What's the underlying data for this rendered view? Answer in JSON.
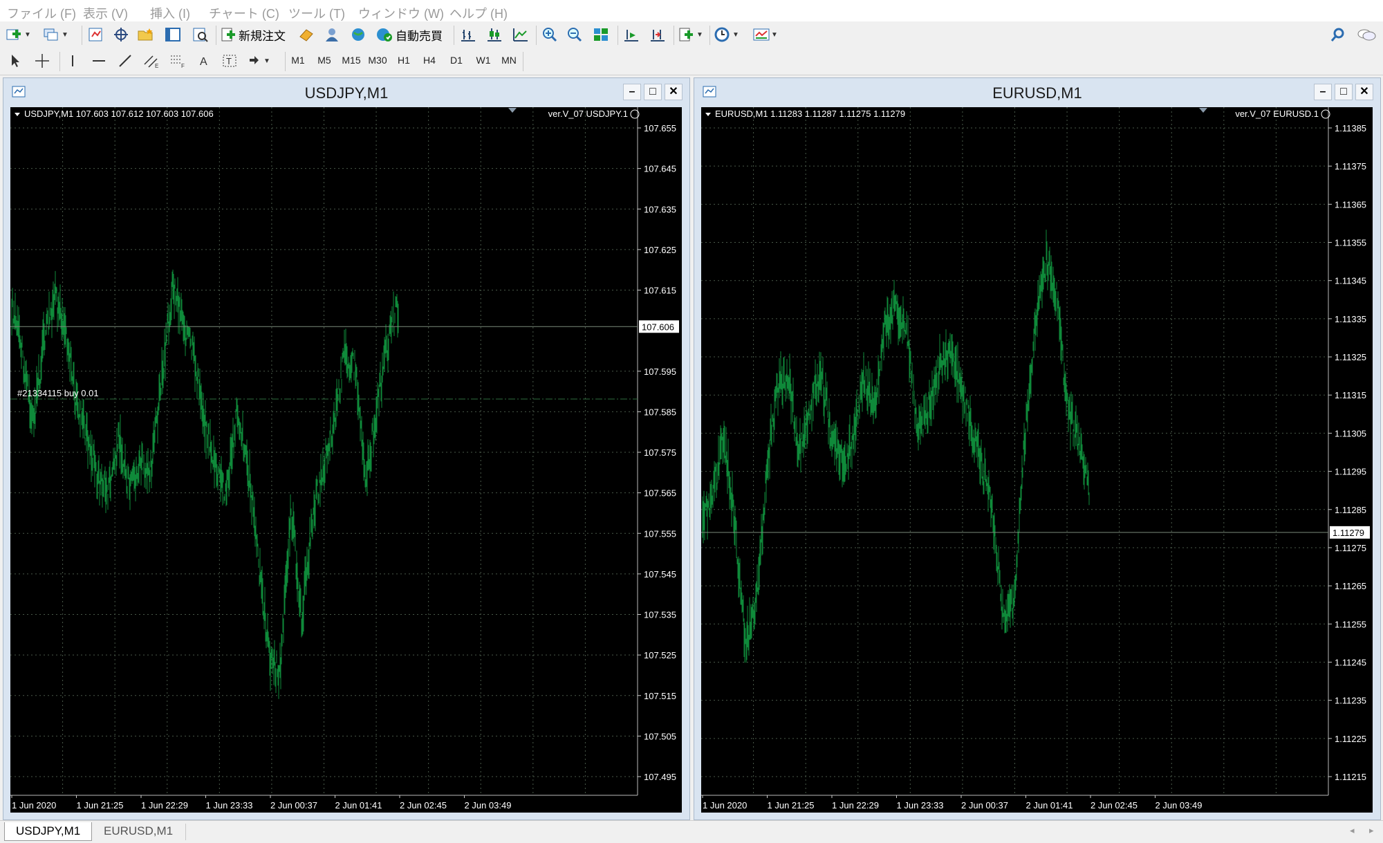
{
  "menu": [
    "ファイル (F)",
    "表示 (V)",
    "挿入 (I)",
    "チャート (C)",
    "ツール (T)",
    "ウィンドウ (W)",
    "ヘルプ (H)"
  ],
  "toolbar": {
    "new_order_label": "新規注文",
    "autotrade_label": "自動売買",
    "timeframes": [
      "M1",
      "M5",
      "M15",
      "M30",
      "H1",
      "H4",
      "D1",
      "W1",
      "MN"
    ]
  },
  "colors": {
    "chart_bg": "#000000",
    "bar": "#0f8a3a",
    "grid": "#4a5a4a",
    "axis_text": "#ffffff",
    "title_bar": "#d9e4f1"
  },
  "charts": [
    {
      "title": "USDJPY,M1",
      "info": "USDJPY,M1  107.603 107.612 107.603 107.606",
      "indicator": "ver.V_07 USDJPY.1",
      "price_labels": [
        "107.655",
        "107.645",
        "107.635",
        "107.625",
        "107.615",
        "107.606",
        "107.595",
        "107.585",
        "107.575",
        "107.565",
        "107.555",
        "107.545",
        "107.535",
        "107.525",
        "107.515",
        "107.505",
        "107.495"
      ],
      "current_price": "107.606",
      "order_label": "#21334115 buy 0.01",
      "time_labels": [
        "1 Jun 2020",
        "1 Jun 21:25",
        "1 Jun 22:29",
        "1 Jun 23:33",
        "2 Jun 00:37",
        "2 Jun 01:41",
        "2 Jun 02:45",
        "2 Jun 03:49"
      ],
      "window_buttons": [
        "–",
        "□",
        "✕"
      ]
    },
    {
      "title": "EURUSD,M1",
      "info": "EURUSD,M1  1.11283 1.11287 1.11275 1.11279",
      "indicator": "ver.V_07 EURUSD.1",
      "price_labels": [
        "1.11385",
        "1.11375",
        "1.11365",
        "1.11355",
        "1.11345",
        "1.11335",
        "1.11325",
        "1.11315",
        "1.11305",
        "1.11295",
        "1.11285",
        "1.11279",
        "1.11275",
        "1.11265",
        "1.11255",
        "1.11245",
        "1.11235",
        "1.11225",
        "1.11215"
      ],
      "current_price": "1.11279",
      "order_label": "",
      "time_labels": [
        "1 Jun 2020",
        "1 Jun 21:25",
        "1 Jun 22:29",
        "1 Jun 23:33",
        "2 Jun 00:37",
        "2 Jun 01:41",
        "2 Jun 02:45",
        "2 Jun 03:49"
      ],
      "window_buttons": [
        "–",
        "□",
        "✕"
      ]
    }
  ],
  "tabs": [
    "USDJPY,M1",
    "EURUSD,M1"
  ],
  "tab_nav": [
    "◂",
    "▸"
  ]
}
